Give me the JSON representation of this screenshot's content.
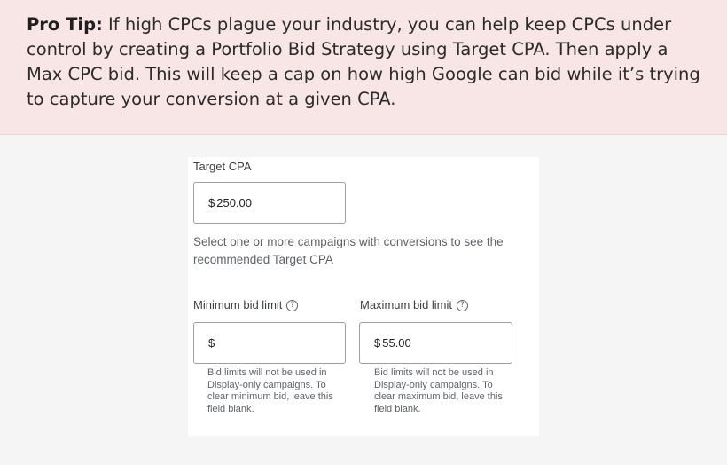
{
  "tip": {
    "label": "Pro Tip:",
    "text": " If high CPCs plague your industry, you can help keep CPCs under control by creating a Portfolio Bid Strategy using Target CPA. Then apply a Max CPC bid. This will keep a cap on how high Google can bid while it’s trying to capture your conversion at a given CPA."
  },
  "form": {
    "target_cpa": {
      "label": "Target CPA",
      "currency": "$",
      "value": "250.00"
    },
    "recommendation_text": "Select one or more campaigns with conversions to see the recommended Target CPA",
    "min_bid": {
      "label": "Minimum bid limit",
      "help_icon": "question-circle-icon",
      "currency": "$",
      "value": "",
      "note": "Bid limits will not be used in Display-only campaigns. To clear minimum bid, leave this field blank."
    },
    "max_bid": {
      "label": "Maximum bid limit",
      "help_icon": "question-circle-icon",
      "currency": "$",
      "value": "55.00",
      "note": "Bid limits will not be used in Display-only campaigns. To clear maximum bid, leave this field blank."
    }
  },
  "colors": {
    "tip_background": "#f8e6e6",
    "page_background": "#f5f5f5",
    "input_border": "#9aa0a6"
  }
}
